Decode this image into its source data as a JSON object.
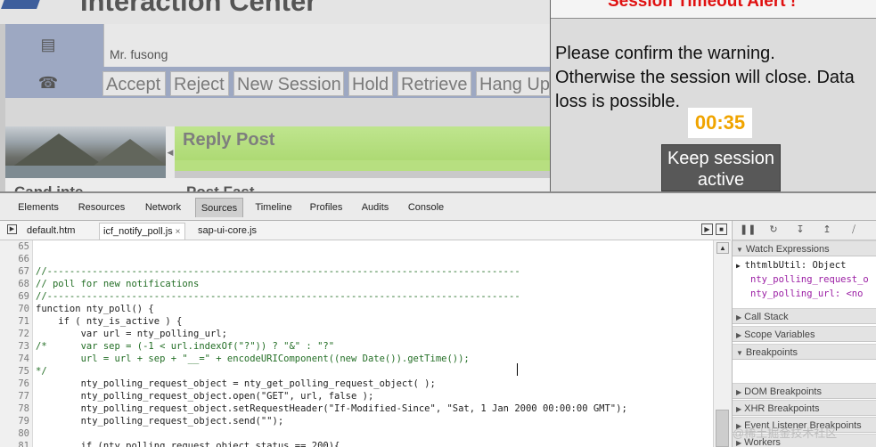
{
  "app": {
    "title": "Interaction Center",
    "caller_name": "Mr. fusong",
    "buttons": [
      "Accept",
      "Reject",
      "New Session",
      "Hold",
      "Retrieve",
      "Hang Up"
    ],
    "reply_title": "Reply Post",
    "section_left": "Cand inte",
    "section_right": "Post Fast"
  },
  "alert": {
    "title": "Session Timeout Alert !",
    "message_lines": [
      "Please confirm the warning.",
      "Otherwise the session will close. Data",
      "loss is possible."
    ],
    "countdown": "00:35",
    "keep_button_line1": "Keep session",
    "keep_button_line2": "active",
    "colors": {
      "title": "#e01010",
      "countdown": "#f0a400",
      "button_bg": "#585858"
    }
  },
  "devtools": {
    "tabs": [
      "Elements",
      "Resources",
      "Network",
      "Sources",
      "Timeline",
      "Profiles",
      "Audits",
      "Console"
    ],
    "active_tab": "Sources",
    "file_tabs": [
      "default.htm",
      "icf_notify_poll.js",
      "sap-ui-core.js"
    ],
    "active_file": "icf_notify_poll.js",
    "close_glyph": "×",
    "code_lines": [
      {
        "n": "65",
        "t": "",
        "comment": false
      },
      {
        "n": "66",
        "t": "",
        "comment": false
      },
      {
        "n": "67",
        "t": "//------------------------------------------------------------------------------------",
        "comment": true
      },
      {
        "n": "68",
        "t": "// poll for new notifications",
        "comment": true
      },
      {
        "n": "69",
        "t": "//------------------------------------------------------------------------------------",
        "comment": true
      },
      {
        "n": "70",
        "t": "function nty_poll() {",
        "comment": false
      },
      {
        "n": "71",
        "t": "    if ( nty_is_active ) {",
        "comment": false
      },
      {
        "n": "72",
        "t": "        var url = nty_polling_url;",
        "comment": false
      },
      {
        "n": "73",
        "t": "/*      var sep = (-1 < url.indexOf(\"?\")) ? \"&\" : \"?\"",
        "comment": true
      },
      {
        "n": "74",
        "t": "        url = url + sep + \"__=\" + encodeURIComponent((new Date()).getTime());",
        "comment": true
      },
      {
        "n": "75",
        "t": "*/",
        "comment": true
      },
      {
        "n": "76",
        "t": "        nty_polling_request_object = nty_get_polling_request_object( );",
        "comment": false
      },
      {
        "n": "77",
        "t": "        nty_polling_request_object.open(\"GET\", url, false );",
        "comment": false
      },
      {
        "n": "78",
        "t": "        nty_polling_request_object.setRequestHeader(\"If-Modified-Since\", \"Sat, 1 Jan 2000 00:00:00 GMT\");",
        "comment": false
      },
      {
        "n": "79",
        "t": "        nty_polling_request_object.send(\"\");",
        "comment": false
      },
      {
        "n": "80",
        "t": "",
        "comment": false
      },
      {
        "n": "81",
        "t": "        if (nty_polling_request_object.status == 200){",
        "comment": false
      }
    ],
    "sidebar": {
      "watch_title": "Watch Expressions",
      "watch_object": "thtmlbUtil: Object",
      "watch_props": [
        "nty_polling_request_o",
        "nty_polling_url: <no"
      ],
      "call_stack": "Call Stack",
      "scope_variables": "Scope Variables",
      "breakpoints": "Breakpoints",
      "dom_breakpoints": "DOM Breakpoints",
      "xhr_breakpoints": "XHR Breakpoints",
      "event_listener_breakpoints": "Event Listener Breakpoints",
      "workers": "Workers"
    }
  },
  "watermark": "@稀土掘金技术社区"
}
